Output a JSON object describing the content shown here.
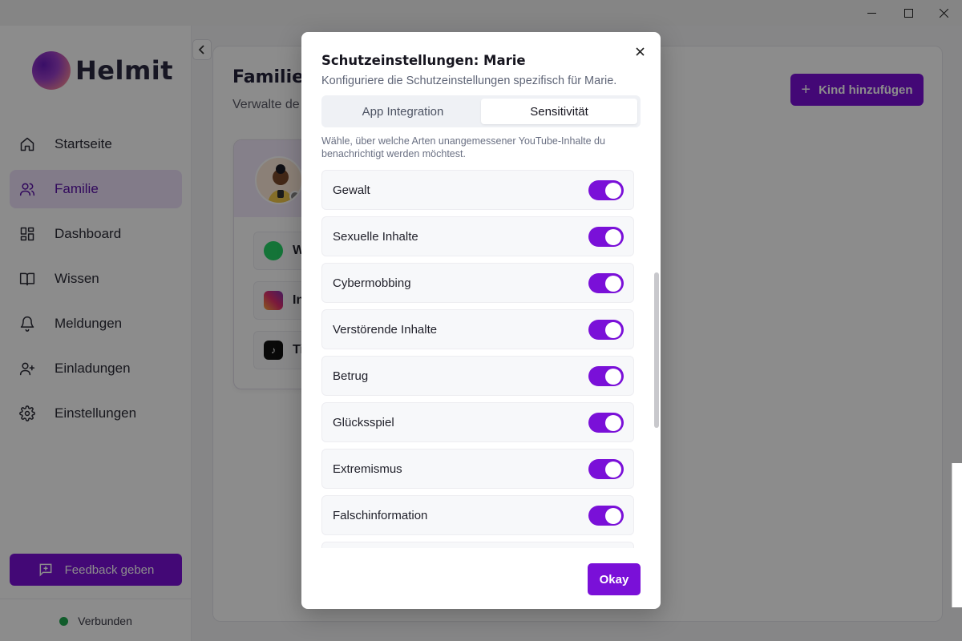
{
  "app": {
    "logo_text": "Helmit"
  },
  "sidebar": {
    "items": [
      {
        "label": "Startseite",
        "icon": "home-icon"
      },
      {
        "label": "Familie",
        "icon": "users-icon"
      },
      {
        "label": "Dashboard",
        "icon": "grid-icon"
      },
      {
        "label": "Wissen",
        "icon": "book-icon"
      },
      {
        "label": "Meldungen",
        "icon": "bell-icon"
      },
      {
        "label": "Einladungen",
        "icon": "user-plus-icon"
      },
      {
        "label": "Einstellungen",
        "icon": "gear-icon"
      }
    ],
    "active_index": 1,
    "feedback_label": "Feedback geben",
    "status_label": "Verbunden",
    "status_color": "#1fa84f"
  },
  "main": {
    "title": "Familie",
    "subtitle": "Verwalte de",
    "add_button_label": "Kind hinzufügen",
    "apps": [
      {
        "label": "W",
        "icon": "whatsapp-icon"
      },
      {
        "label": "In",
        "icon": "instagram-icon"
      },
      {
        "label": "Ti",
        "icon": "tiktok-icon"
      }
    ]
  },
  "dialog": {
    "title": "Schutzeinstellungen: Marie",
    "subtitle": "Konfiguriere die Schutzeinstellungen spezifisch für Marie.",
    "tabs": [
      "App Integration",
      "Sensitivität"
    ],
    "active_tab": 1,
    "description": "Wähle, über welche Arten unangemessener YouTube-Inhalte du benachrichtigt werden möchtest.",
    "categories": [
      {
        "label": "Gewalt",
        "enabled": true
      },
      {
        "label": "Sexuelle Inhalte",
        "enabled": true
      },
      {
        "label": "Cybermobbing",
        "enabled": true
      },
      {
        "label": "Verstörende Inhalte",
        "enabled": true
      },
      {
        "label": "Betrug",
        "enabled": true
      },
      {
        "label": "Glücksspiel",
        "enabled": true
      },
      {
        "label": "Extremismus",
        "enabled": true
      },
      {
        "label": "Falschinformation",
        "enabled": true
      }
    ],
    "ok_label": "Okay"
  },
  "colors": {
    "accent": "#7a10d8",
    "active_nav_bg": "#ede1fa"
  }
}
